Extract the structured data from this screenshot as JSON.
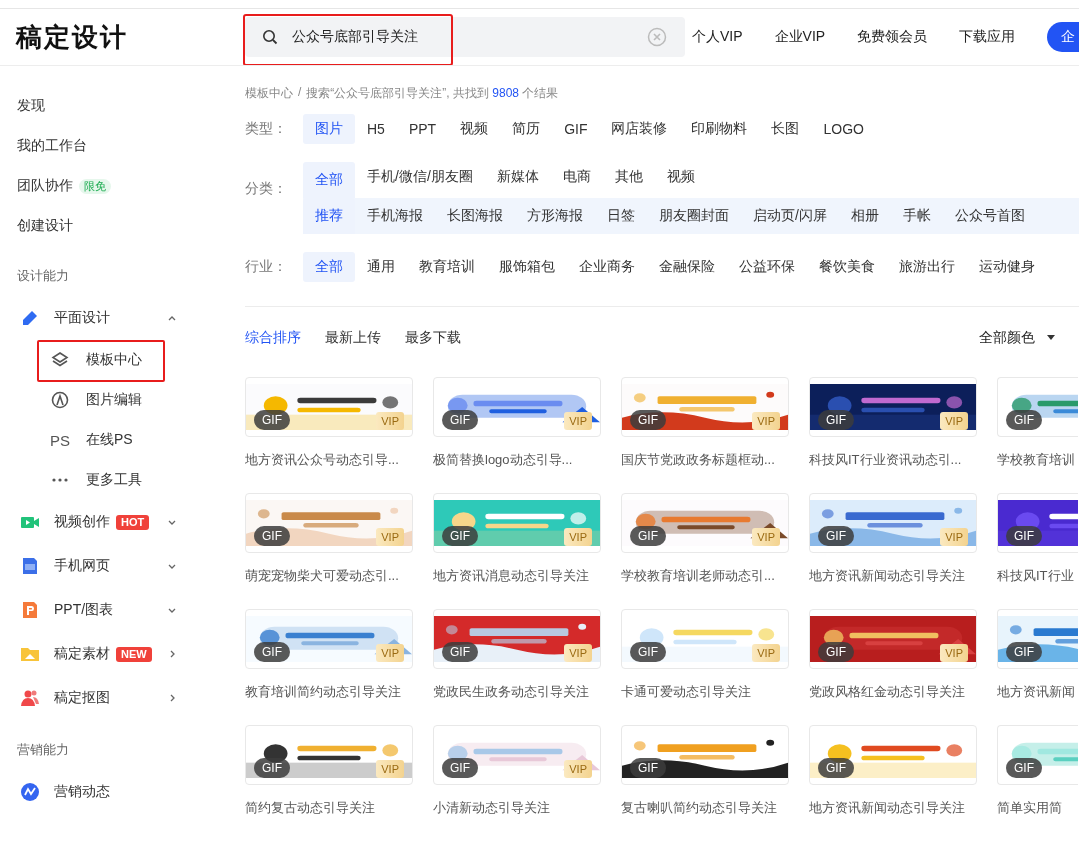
{
  "header": {
    "logo": "稿定设计",
    "search": {
      "value": "公众号底部引导关注",
      "highlighted": true
    },
    "nav": [
      "个人VIP",
      "企业VIP",
      "免费领会员",
      "下载应用"
    ],
    "cta_button": "企"
  },
  "sidebar": {
    "links": [
      {
        "label": "发现"
      },
      {
        "label": "我的工作台"
      },
      {
        "label": "团队协作",
        "badge": {
          "text": "限免",
          "kind": "trial"
        }
      },
      {
        "label": "创建设计"
      }
    ],
    "sections": [
      {
        "title": "设计能力",
        "items": [
          {
            "label": "平面设计",
            "kind": "dropdown",
            "expanded": true,
            "children": [
              {
                "label": "模板中心",
                "highlighted": true
              },
              {
                "label": "图片编辑",
                "highlighted": false
              },
              {
                "label": "在线PS",
                "icon_text": "PS",
                "highlighted": false
              },
              {
                "label": "更多工具",
                "highlighted": false
              }
            ]
          },
          {
            "label": "视频创作",
            "kind": "dropdown",
            "expanded": false,
            "badge": {
              "text": "HOT",
              "kind": "promo"
            }
          },
          {
            "label": "手机网页",
            "kind": "dropdown",
            "expanded": false
          },
          {
            "label": "PPT/图表",
            "kind": "dropdown",
            "expanded": false
          },
          {
            "label": "稿定素材",
            "kind": "flyout",
            "badge": {
              "text": "NEW",
              "kind": "promo"
            }
          },
          {
            "label": "稿定抠图",
            "kind": "flyout"
          }
        ]
      },
      {
        "title": "营销能力",
        "items": [
          {
            "label": "营销动态",
            "kind": "link"
          }
        ]
      }
    ]
  },
  "breadcrumb": {
    "root": "模板中心",
    "separator": "/",
    "text_before": "搜索“公众号底部引导关注”, 共找到 ",
    "count": "9808",
    "text_after": " 个结果"
  },
  "filters": [
    {
      "label": "类型：",
      "options": [
        {
          "label": "图片",
          "selected": true
        },
        {
          "label": "H5",
          "selected": false
        },
        {
          "label": "PPT",
          "selected": false
        },
        {
          "label": "视频",
          "selected": false
        },
        {
          "label": "简历",
          "selected": false
        },
        {
          "label": "GIF",
          "selected": false
        },
        {
          "label": "网店装修",
          "selected": false
        },
        {
          "label": "印刷物料",
          "selected": false
        },
        {
          "label": "长图",
          "selected": false
        },
        {
          "label": "LOGO",
          "selected": false
        }
      ]
    },
    {
      "label": "分类：",
      "options": [
        {
          "label": "全部",
          "selected": true
        },
        {
          "label": "手机/微信/朋友圈",
          "selected": false
        },
        {
          "label": "新媒体",
          "selected": false
        },
        {
          "label": "电商",
          "selected": false
        },
        {
          "label": "其他",
          "selected": false
        },
        {
          "label": "视频",
          "selected": false
        }
      ],
      "suboptions": [
        {
          "label": "推荐",
          "selected": true
        },
        {
          "label": "手机海报",
          "selected": false
        },
        {
          "label": "长图海报",
          "selected": false
        },
        {
          "label": "方形海报",
          "selected": false
        },
        {
          "label": "日签",
          "selected": false
        },
        {
          "label": "朋友圈封面",
          "selected": false
        },
        {
          "label": "启动页/闪屏",
          "selected": false
        },
        {
          "label": "相册",
          "selected": false
        },
        {
          "label": "手帐",
          "selected": false
        },
        {
          "label": "公众号首图",
          "selected": false
        }
      ]
    },
    {
      "label": "行业：",
      "options": [
        {
          "label": "全部",
          "selected": true
        },
        {
          "label": "通用",
          "selected": false
        },
        {
          "label": "教育培训",
          "selected": false
        },
        {
          "label": "服饰箱包",
          "selected": false
        },
        {
          "label": "企业商务",
          "selected": false
        },
        {
          "label": "金融保险",
          "selected": false
        },
        {
          "label": "公益环保",
          "selected": false
        },
        {
          "label": "餐饮美食",
          "selected": false
        },
        {
          "label": "旅游出行",
          "selected": false
        },
        {
          "label": "运动健身",
          "selected": false
        }
      ]
    }
  ],
  "sort": {
    "options": [
      {
        "label": "综合排序",
        "selected": true
      },
      {
        "label": "最新上传",
        "selected": false
      },
      {
        "label": "最多下载",
        "selected": false
      }
    ],
    "color_filter": "全部颜色"
  },
  "templates": [
    {
      "title": "地方资讯公众号动态引导...",
      "gif": "GIF",
      "vip": "VIP"
    },
    {
      "title": "极简替换logo动态引导...",
      "gif": "GIF",
      "vip": "VIP"
    },
    {
      "title": "国庆节党政政务标题框动...",
      "gif": "GIF",
      "vip": "VIP"
    },
    {
      "title": "科技风IT行业资讯动态引...",
      "gif": "GIF",
      "vip": "VIP"
    },
    {
      "title": "学校教育培训",
      "gif": "GIF"
    },
    {
      "title": "萌宠宠物柴犬可爱动态引...",
      "gif": "GIF",
      "vip": "VIP"
    },
    {
      "title": "地方资讯消息动态引导关注",
      "gif": "GIF",
      "vip": "VIP"
    },
    {
      "title": "学校教育培训老师动态引...",
      "gif": "GIF",
      "vip": "VIP"
    },
    {
      "title": "地方资讯新闻动态引导关注",
      "gif": "GIF",
      "vip": "VIP"
    },
    {
      "title": "科技风IT行业",
      "gif": "GIF"
    },
    {
      "title": "教育培训简约动态引导关注",
      "gif": "GIF",
      "vip": "VIP"
    },
    {
      "title": "党政民生政务动态引导关注",
      "gif": "GIF",
      "vip": "VIP"
    },
    {
      "title": "卡通可爱动态引导关注",
      "gif": "GIF",
      "vip": "VIP"
    },
    {
      "title": "党政风格红金动态引导关注",
      "gif": "GIF",
      "vip": "VIP"
    },
    {
      "title": "地方资讯新闻",
      "gif": "GIF"
    },
    {
      "title": "简约复古动态引导关注",
      "gif": "GIF",
      "vip": "VIP"
    },
    {
      "title": "小清新动态引导关注",
      "gif": "GIF",
      "vip": "VIP"
    },
    {
      "title": "复古喇叭简约动态引导关注",
      "gif": "GIF"
    },
    {
      "title": "地方资讯新闻动态引导关注",
      "gif": "GIF"
    },
    {
      "title": "简单实用简",
      "gif": "GIF"
    }
  ]
}
